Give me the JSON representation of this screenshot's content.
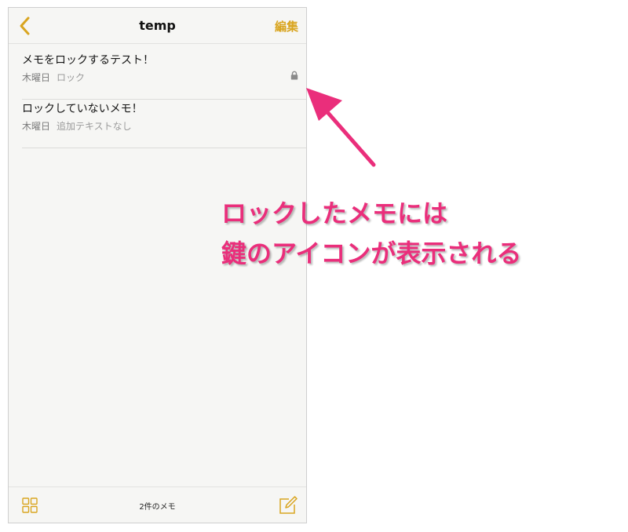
{
  "navbar": {
    "back_icon": "chevron-left-icon",
    "title": "temp",
    "edit_label": "編集"
  },
  "notes": [
    {
      "title": "メモをロックするテスト！",
      "date": "木曜日",
      "preview": "ロック",
      "locked": true
    },
    {
      "title": "ロックしていないメモ！",
      "date": "木曜日",
      "preview": "追加テキストなし",
      "locked": false
    }
  ],
  "toolbar": {
    "count_label": "2件のメモ",
    "grid_icon": "grid-icon",
    "compose_icon": "compose-icon"
  },
  "annotation": {
    "line1": "ロックしたメモには",
    "line2": "鍵のアイコンが表示される"
  },
  "colors": {
    "accent": "#d9a520",
    "annotation": "#ea2e7b"
  }
}
